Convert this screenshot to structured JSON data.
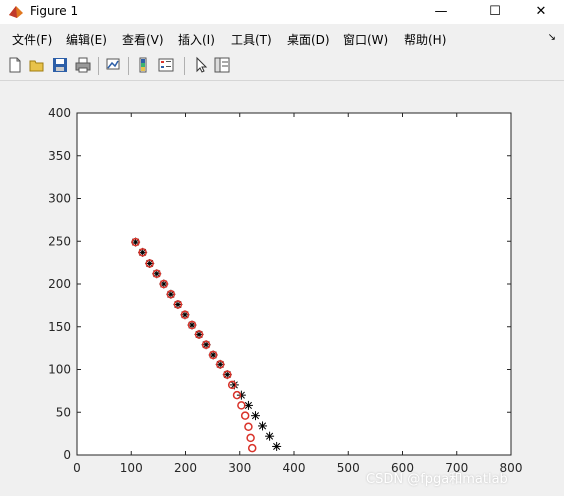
{
  "window": {
    "title": "Figure 1",
    "minimize": "—",
    "maximize": "☐",
    "close": "✕"
  },
  "menu": [
    {
      "label": "文件(F)"
    },
    {
      "label": "编辑(E)"
    },
    {
      "label": "查看(V)"
    },
    {
      "label": "插入(I)"
    },
    {
      "label": "工具(T)"
    },
    {
      "label": "桌面(D)"
    },
    {
      "label": "窗口(W)"
    },
    {
      "label": "帮助(H)"
    }
  ],
  "toolbar_icons": [
    "new-figure-icon",
    "open-file-icon",
    "save-icon",
    "print-icon",
    "link-plot-icon",
    "insert-colorbar-icon",
    "insert-legend-icon",
    "edit-plot-arrow-icon",
    "property-inspector-icon"
  ],
  "watermark": "CSDN @fpga和matlab",
  "chart_data": {
    "type": "scatter",
    "xlim": [
      0,
      800
    ],
    "ylim": [
      0,
      400
    ],
    "xticks": [
      0,
      100,
      200,
      300,
      400,
      500,
      600,
      700,
      800
    ],
    "yticks": [
      0,
      50,
      100,
      150,
      200,
      250,
      300,
      350,
      400
    ],
    "grid": false,
    "series": [
      {
        "marker": "star",
        "color": "#000000",
        "x": [
          108,
          121,
          134,
          147,
          160,
          173,
          186,
          199,
          212,
          225,
          238,
          251,
          264,
          277,
          290,
          303,
          316,
          329,
          342,
          355,
          368
        ],
        "y": [
          249,
          237,
          224,
          212,
          200,
          188,
          176,
          164,
          152,
          141,
          129,
          117,
          106,
          94,
          82,
          70,
          58,
          46,
          34,
          22,
          10
        ]
      },
      {
        "marker": "circle",
        "color": "#d9332a",
        "x": [
          108,
          121,
          134,
          147,
          160,
          173,
          186,
          199,
          212,
          225,
          238,
          251,
          264,
          277,
          286,
          295,
          303,
          310,
          316,
          320,
          323
        ],
        "y": [
          249,
          237,
          224,
          212,
          200,
          188,
          176,
          164,
          152,
          141,
          129,
          117,
          106,
          94,
          82,
          70,
          58,
          46,
          33,
          20,
          8
        ]
      }
    ]
  }
}
